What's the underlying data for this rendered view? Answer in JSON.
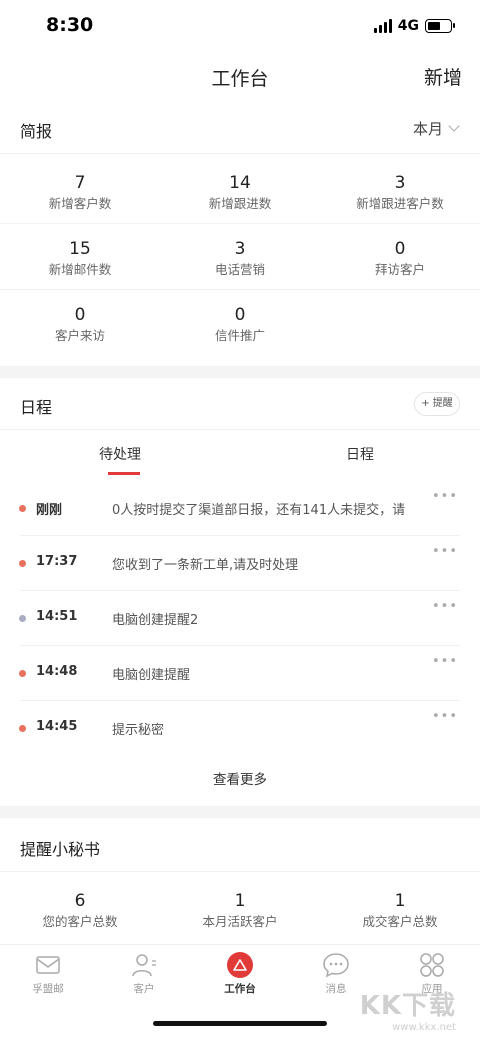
{
  "status_bar": {
    "time": "8:30",
    "network": "4G"
  },
  "header": {
    "title": "工作台",
    "add_label": "新增"
  },
  "briefing": {
    "title": "简报",
    "period": "本月",
    "stats": [
      {
        "value": "7",
        "label": "新增客户数"
      },
      {
        "value": "14",
        "label": "新增跟进数"
      },
      {
        "value": "3",
        "label": "新增跟进客户数"
      },
      {
        "value": "15",
        "label": "新增邮件数"
      },
      {
        "value": "3",
        "label": "电话营销"
      },
      {
        "value": "0",
        "label": "拜访客户"
      },
      {
        "value": "0",
        "label": "客户来访"
      },
      {
        "value": "0",
        "label": "信件推广"
      }
    ]
  },
  "schedule": {
    "title": "日程",
    "remind_label": "+ 提醒",
    "tabs": [
      {
        "label": "待处理"
      },
      {
        "label": "日程"
      }
    ],
    "tasks": [
      {
        "time": "刚刚",
        "text": "0人按时提交了渠道部日报，还有141人未提交，请",
        "dot": "#e8705f"
      },
      {
        "time": "17:37",
        "text": "您收到了一条新工单,请及时处理",
        "dot": "#e8705f"
      },
      {
        "time": "14:51",
        "text": "电脑创建提醒2",
        "dot": "#a8adc4"
      },
      {
        "time": "14:48",
        "text": "电脑创建提醒",
        "dot": "#e8705f"
      },
      {
        "time": "14:45",
        "text": "提示秘密",
        "dot": "#e8705f"
      }
    ],
    "more_glyph": "•••",
    "view_more": "查看更多"
  },
  "secretary": {
    "title": "提醒小秘书",
    "stats": [
      {
        "value": "6",
        "label": "您的客户总数"
      },
      {
        "value": "1",
        "label": "本月活跃客户"
      },
      {
        "value": "1",
        "label": "成交客户总数"
      }
    ]
  },
  "bottom_nav": {
    "items": [
      {
        "label": "孚盟邮",
        "icon": "mail-icon"
      },
      {
        "label": "客户",
        "icon": "contacts-icon"
      },
      {
        "label": "工作台",
        "icon": "workbench-icon"
      },
      {
        "label": "消息",
        "icon": "message-icon"
      },
      {
        "label": "应用",
        "icon": "apps-icon"
      }
    ]
  },
  "watermark": {
    "logo": "KK下载",
    "url": "www.kkx.net"
  },
  "colors": {
    "accent": "#e03a3a",
    "dot_red": "#e8705f",
    "dot_gray": "#a8adc4"
  }
}
